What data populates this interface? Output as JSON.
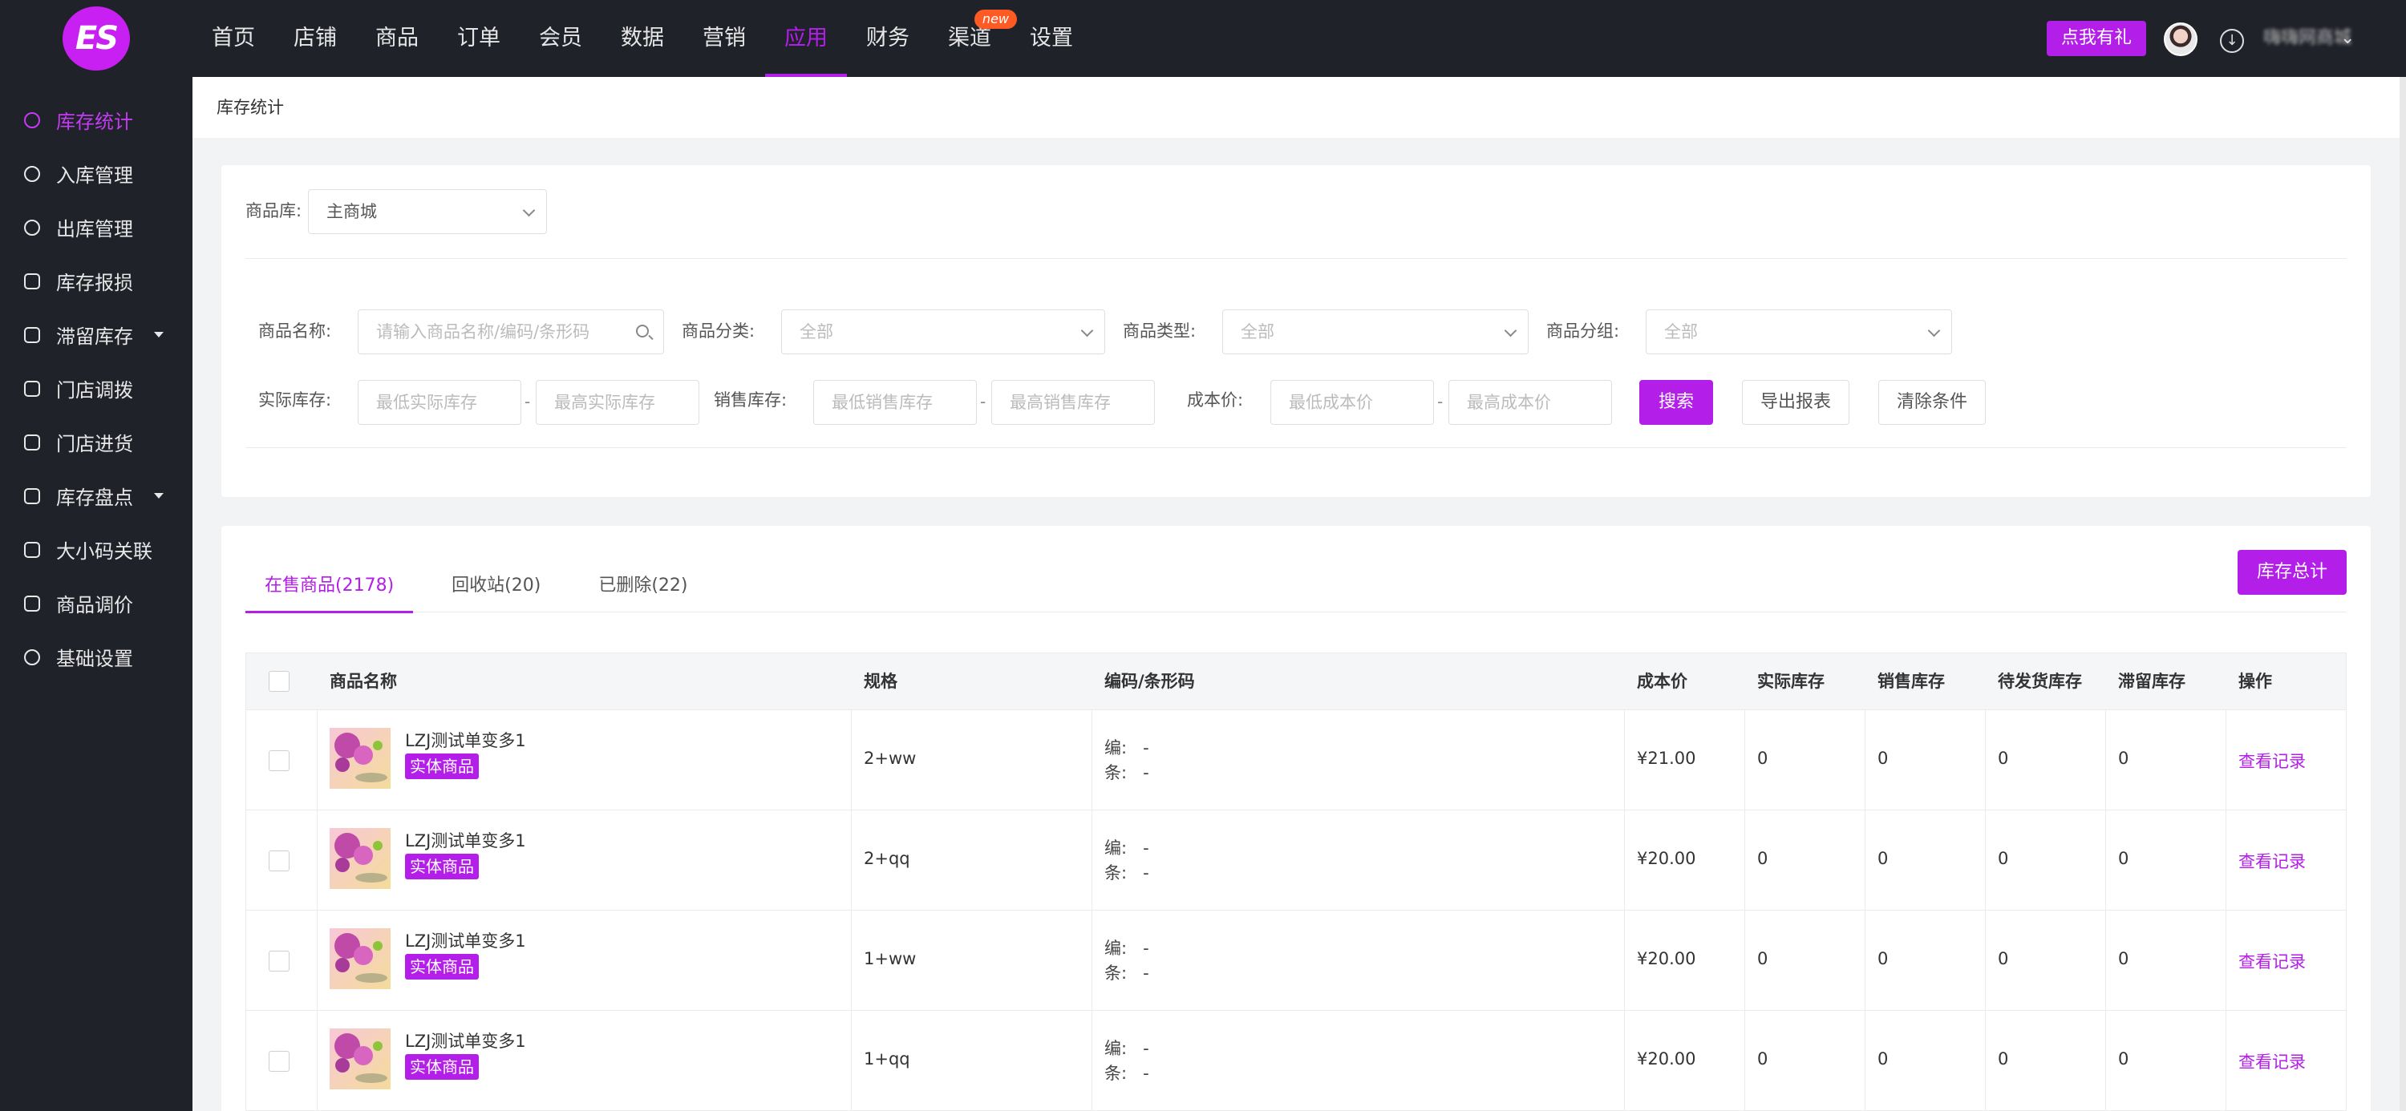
{
  "header": {
    "logo_text": "ES",
    "nav": [
      {
        "label": "首页"
      },
      {
        "label": "店铺"
      },
      {
        "label": "商品"
      },
      {
        "label": "订单"
      },
      {
        "label": "会员"
      },
      {
        "label": "数据"
      },
      {
        "label": "营销"
      },
      {
        "label": "应用"
      },
      {
        "label": "财务"
      },
      {
        "label": "渠道"
      },
      {
        "label": "设置"
      }
    ],
    "active_nav": "应用",
    "new_badge": "new",
    "gift_button": "点我有礼",
    "username": "嗨嗨网商城",
    "accent_color": "#b31ee8"
  },
  "sidebar": {
    "items": [
      {
        "label": "库存统计",
        "icon": "chart-icon"
      },
      {
        "label": "入库管理",
        "icon": "inbound-icon"
      },
      {
        "label": "出库管理",
        "icon": "outbound-icon"
      },
      {
        "label": "库存报损",
        "icon": "report-icon"
      },
      {
        "label": "滞留库存",
        "icon": "stock-icon"
      },
      {
        "label": "门店调拨",
        "icon": "transfer-icon"
      },
      {
        "label": "门店进货",
        "icon": "cart-icon"
      },
      {
        "label": "库存盘点",
        "icon": "inventory-icon"
      },
      {
        "label": "大小码关联",
        "icon": "link-icon"
      },
      {
        "label": "商品调价",
        "icon": "price-icon"
      },
      {
        "label": "基础设置",
        "icon": "settings-icon"
      }
    ]
  },
  "breadcrumb": "库存统计",
  "filters": {
    "warehouse_label": "商品库:",
    "warehouse_value": "主商城",
    "name_label": "商品名称:",
    "name_placeholder": "请输入商品名称/编码/条形码",
    "category_label": "商品分类:",
    "category_value": "全部",
    "type_label": "商品类型:",
    "type_value": "全部",
    "group_label": "商品分组:",
    "group_value": "全部",
    "actual_stock_label": "实际库存:",
    "actual_min_placeholder": "最低实际库存",
    "actual_max_placeholder": "最高实际库存",
    "sale_stock_label": "销售库存:",
    "sale_min_placeholder": "最低销售库存",
    "sale_max_placeholder": "最高销售库存",
    "cost_label": "成本价:",
    "cost_min_placeholder": "最低成本价",
    "cost_max_placeholder": "最高成本价",
    "range_separator": "-",
    "search_button": "搜索",
    "export_button": "导出报表",
    "clear_button": "清除条件"
  },
  "tabs": [
    {
      "label": "在售商品(2178)"
    },
    {
      "label": "回收站(20)"
    },
    {
      "label": "已删除(22)"
    }
  ],
  "stock_total_button": "库存总计",
  "table": {
    "columns": [
      "商品名称",
      "规格",
      "编码/条形码",
      "成本价",
      "实际库存",
      "销售库存",
      "待发货库存",
      "滞留库存",
      "操作"
    ],
    "rows": [
      {
        "name": "LZJ测试单变多1",
        "tag": "实体商品",
        "spec": "2+ww",
        "code_label": "编:",
        "code": "-",
        "barcode_label": "条:",
        "barcode": "-",
        "cost": "¥21.00",
        "actual": "0",
        "sale": "0",
        "pending": "0",
        "stranded": "0",
        "action": "查看记录"
      },
      {
        "name": "LZJ测试单变多1",
        "tag": "实体商品",
        "spec": "2+qq",
        "code_label": "编:",
        "code": "-",
        "barcode_label": "条:",
        "barcode": "-",
        "cost": "¥20.00",
        "actual": "0",
        "sale": "0",
        "pending": "0",
        "stranded": "0",
        "action": "查看记录"
      },
      {
        "name": "LZJ测试单变多1",
        "tag": "实体商品",
        "spec": "1+ww",
        "code_label": "编:",
        "code": "-",
        "barcode_label": "条:",
        "barcode": "-",
        "cost": "¥20.00",
        "actual": "0",
        "sale": "0",
        "pending": "0",
        "stranded": "0",
        "action": "查看记录"
      },
      {
        "name": "LZJ测试单变多1",
        "tag": "实体商品",
        "spec": "1+qq",
        "code_label": "编:",
        "code": "-",
        "barcode_label": "条:",
        "barcode": "-",
        "cost": "¥20.00",
        "actual": "0",
        "sale": "0",
        "pending": "0",
        "stranded": "0",
        "action": "查看记录"
      }
    ]
  }
}
